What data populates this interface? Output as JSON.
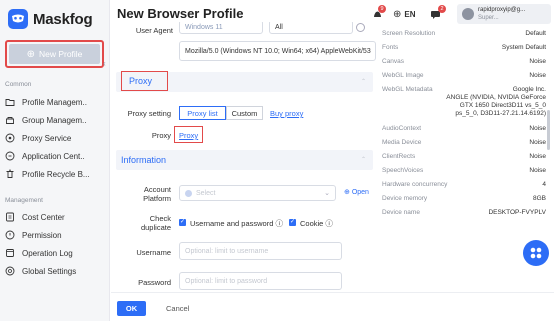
{
  "app": {
    "name": "Maskfog"
  },
  "sidebar": {
    "new_profile_label": "New Profile",
    "common_label": "Common",
    "management_label": "Management",
    "common_items": [
      {
        "label": "Profile Managem..",
        "icon": "folder-icon"
      },
      {
        "label": "Group Managem..",
        "icon": "group-icon"
      },
      {
        "label": "Proxy Service",
        "icon": "proxy-icon"
      },
      {
        "label": "Application Cent..",
        "icon": "app-icon"
      },
      {
        "label": "Profile Recycle B...",
        "icon": "trash-icon"
      }
    ],
    "management_items": [
      {
        "label": "Cost Center",
        "icon": "cost-icon"
      },
      {
        "label": "Permission",
        "icon": "permission-icon"
      },
      {
        "label": "Operation Log",
        "icon": "log-icon"
      },
      {
        "label": "Global Settings",
        "icon": "settings-icon"
      }
    ]
  },
  "header": {
    "title": "New Browser Profile",
    "badge_bell": "9",
    "language": "EN",
    "badge_msg": "2",
    "user_name": "rapidproxyip@g...",
    "user_role": "Super..."
  },
  "form": {
    "user_agent_label": "User Agent",
    "ua_select_1": "Windows 11",
    "ua_select_2": "All",
    "ua_value": "Mozilla/5.0 (Windows NT 10.0; Win64; x64) AppleWebKit/53",
    "proxy_section_title": "Proxy",
    "proxy_setting_label": "Proxy setting",
    "proxy_tabs": [
      "Proxy list",
      "Custom"
    ],
    "buy_proxy_link": "Buy proxy",
    "proxy_label": "Proxy",
    "proxy_link": "Proxy",
    "information_section_title": "Information",
    "account_platform_label_1": "Account",
    "account_platform_label_2": "Platform",
    "account_platform_placeholder": "Select",
    "open_label": "Open",
    "check_duplicate_label_1": "Check",
    "check_duplicate_label_2": "duplicate",
    "check_options": [
      "Username and password ⓘ",
      "Cookie ⓘ"
    ],
    "username_label": "Username",
    "username_placeholder": "Optional: limit to username",
    "password_label": "Password",
    "password_placeholder": "Optional: limit to password"
  },
  "footer": {
    "ok_label": "OK",
    "cancel_label": "Cancel"
  },
  "fingerprint": [
    {
      "label": "Screen Resolution",
      "value": "Default"
    },
    {
      "label": "Fonts",
      "value": "System Default"
    },
    {
      "label": "Canvas",
      "value": "Noise"
    },
    {
      "label": "WebGL Image",
      "value": "Noise"
    },
    {
      "label": "WebGL Metadata",
      "value": "Google Inc."
    },
    {
      "label": "",
      "value": "ANGLE (NVIDIA, NVIDIA GeForce"
    },
    {
      "label": "",
      "value": "GTX 1650 Direct3D11 vs_5_0"
    },
    {
      "label": "",
      "value": "ps_5_0, D3D11-27.21.14.6192)"
    },
    {
      "label": "AudioContext",
      "value": "Noise"
    },
    {
      "label": "Media Device",
      "value": "Noise"
    },
    {
      "label": "ClientRects",
      "value": "Noise"
    },
    {
      "label": "SpeechVoices",
      "value": "Noise"
    },
    {
      "label": "Hardware concurrency",
      "value": "4"
    },
    {
      "label": "Device memory",
      "value": "8GB"
    },
    {
      "label": "Device name",
      "value": "DESKTOP-FVYPLV"
    }
  ],
  "colors": {
    "accent": "#2d6df6",
    "highlight": "#e24a4a"
  }
}
